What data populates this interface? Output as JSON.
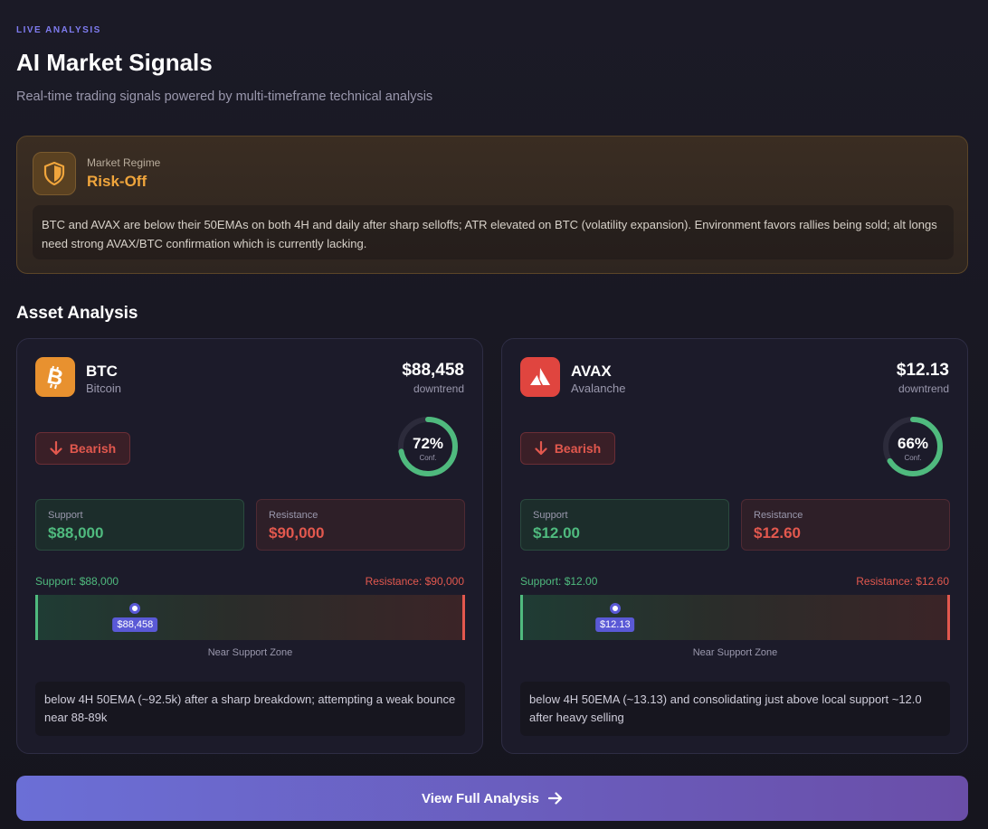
{
  "header": {
    "eyebrow": "LIVE ANALYSIS",
    "title": "AI Market Signals",
    "subtitle": "Real-time trading signals powered by multi-timeframe technical analysis"
  },
  "regime": {
    "label": "Market Regime",
    "value": "Risk-Off",
    "icon": "shield-icon",
    "description": "BTC and AVAX are below their 50EMAs on both 4H and daily after sharp selloffs; ATR elevated on BTC (volatility expansion). Environment favors rallies being sold; alt longs need strong AVAX/BTC confirmation which is currently lacking."
  },
  "section_title": "Asset Analysis",
  "assets": [
    {
      "symbol": "BTC",
      "name": "Bitcoin",
      "icon": "bitcoin-icon",
      "price": "$88,458",
      "trend": "downtrend",
      "bias": "Bearish",
      "confidence_pct": "72%",
      "confidence_value": 0.72,
      "confidence_label": "Conf.",
      "support_label": "Support",
      "support": "$88,000",
      "resistance_label": "Resistance",
      "resistance": "$90,000",
      "range_support": "Support: $88,000",
      "range_resistance": "Resistance: $90,000",
      "current_tag": "$88,458",
      "position_in_range": 0.229,
      "zone": "Near Support Zone",
      "note": "below 4H 50EMA (~92.5k) after a sharp breakdown; attempting a weak bounce near 88-89k"
    },
    {
      "symbol": "AVAX",
      "name": "Avalanche",
      "icon": "avalanche-icon",
      "price": "$12.13",
      "trend": "downtrend",
      "bias": "Bearish",
      "confidence_pct": "66%",
      "confidence_value": 0.66,
      "confidence_label": "Conf.",
      "support_label": "Support",
      "support": "$12.00",
      "resistance_label": "Resistance",
      "resistance": "$12.60",
      "range_support": "Support: $12.00",
      "range_resistance": "Resistance: $12.60",
      "current_tag": "$12.13",
      "position_in_range": 0.217,
      "zone": "Near Support Zone",
      "note": "below 4H 50EMA (~13.13) and consolidating just above local support ~12.0 after heavy selling"
    }
  ],
  "cta_label": "View Full Analysis",
  "colors": {
    "accent": "#7f7cf0",
    "bullish": "#4fba7e",
    "bearish": "#e2584e",
    "regime": "#f0a53c",
    "btc_brand": "#e8912f",
    "avax_brand": "#e0453f"
  }
}
